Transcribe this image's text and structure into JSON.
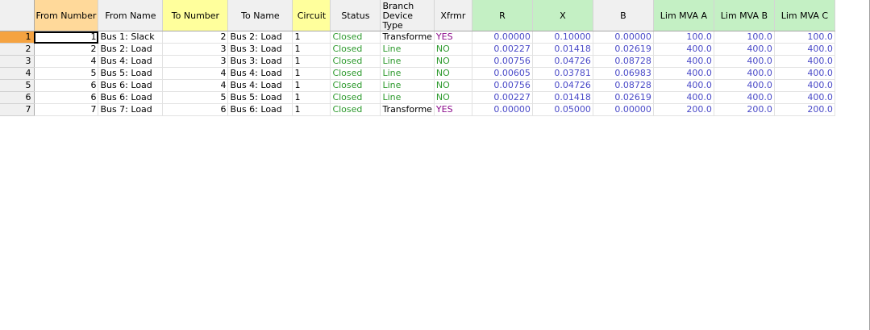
{
  "columns": [
    {
      "key": "from_number",
      "label": "From Number"
    },
    {
      "key": "from_name",
      "label": "From Name"
    },
    {
      "key": "to_number",
      "label": "To Number"
    },
    {
      "key": "to_name",
      "label": "To Name"
    },
    {
      "key": "circuit",
      "label": "Circuit"
    },
    {
      "key": "status",
      "label": "Status"
    },
    {
      "key": "branch_device_type",
      "label": "Branch Device Type"
    },
    {
      "key": "xfrmr",
      "label": "Xfrmr"
    },
    {
      "key": "r",
      "label": "R"
    },
    {
      "key": "x",
      "label": "X"
    },
    {
      "key": "b",
      "label": "B"
    },
    {
      "key": "lim_mva_a",
      "label": "Lim MVA A"
    },
    {
      "key": "lim_mva_b",
      "label": "Lim MVA B"
    },
    {
      "key": "lim_mva_c",
      "label": "Lim MVA C"
    }
  ],
  "rows": [
    {
      "row": "1",
      "from_number": "1",
      "from_name": "Bus 1: Slack",
      "to_number": "2",
      "to_name": "Bus 2: Load",
      "circuit": "1",
      "status": "Closed",
      "branch_device_type": "Transforme",
      "xfrmr": "YES",
      "r": "0.00000",
      "x": "0.10000",
      "b": "0.00000",
      "lim_mva_a": "100.0",
      "lim_mva_b": "100.0",
      "lim_mva_c": "100.0"
    },
    {
      "row": "2",
      "from_number": "2",
      "from_name": "Bus 2: Load",
      "to_number": "3",
      "to_name": "Bus 3: Load",
      "circuit": "1",
      "status": "Closed",
      "branch_device_type": "Line",
      "xfrmr": "NO",
      "r": "0.00227",
      "x": "0.01418",
      "b": "0.02619",
      "lim_mva_a": "400.0",
      "lim_mva_b": "400.0",
      "lim_mva_c": "400.0"
    },
    {
      "row": "3",
      "from_number": "4",
      "from_name": "Bus 4: Load",
      "to_number": "3",
      "to_name": "Bus 3: Load",
      "circuit": "1",
      "status": "Closed",
      "branch_device_type": "Line",
      "xfrmr": "NO",
      "r": "0.00756",
      "x": "0.04726",
      "b": "0.08728",
      "lim_mva_a": "400.0",
      "lim_mva_b": "400.0",
      "lim_mva_c": "400.0"
    },
    {
      "row": "4",
      "from_number": "5",
      "from_name": "Bus 5: Load",
      "to_number": "4",
      "to_name": "Bus 4: Load",
      "circuit": "1",
      "status": "Closed",
      "branch_device_type": "Line",
      "xfrmr": "NO",
      "r": "0.00605",
      "x": "0.03781",
      "b": "0.06983",
      "lim_mva_a": "400.0",
      "lim_mva_b": "400.0",
      "lim_mva_c": "400.0"
    },
    {
      "row": "5",
      "from_number": "6",
      "from_name": "Bus 6: Load",
      "to_number": "4",
      "to_name": "Bus 4: Load",
      "circuit": "1",
      "status": "Closed",
      "branch_device_type": "Line",
      "xfrmr": "NO",
      "r": "0.00756",
      "x": "0.04726",
      "b": "0.08728",
      "lim_mva_a": "400.0",
      "lim_mva_b": "400.0",
      "lim_mva_c": "400.0"
    },
    {
      "row": "6",
      "from_number": "6",
      "from_name": "Bus 6: Load",
      "to_number": "5",
      "to_name": "Bus 5: Load",
      "circuit": "1",
      "status": "Closed",
      "branch_device_type": "Line",
      "xfrmr": "NO",
      "r": "0.00227",
      "x": "0.01418",
      "b": "0.02619",
      "lim_mva_a": "400.0",
      "lim_mva_b": "400.0",
      "lim_mva_c": "400.0"
    },
    {
      "row": "7",
      "from_number": "7",
      "from_name": "Bus 7: Load",
      "to_number": "6",
      "to_name": "Bus 6: Load",
      "circuit": "1",
      "status": "Closed",
      "branch_device_type": "Transforme",
      "xfrmr": "YES",
      "r": "0.00000",
      "x": "0.05000",
      "b": "0.00000",
      "lim_mva_a": "200.0",
      "lim_mva_b": "200.0",
      "lim_mva_c": "200.0"
    }
  ],
  "colors": {
    "header_key_from": "#ffd99a",
    "header_key_to": "#ffff9c",
    "header_editable": "#c4f0c4",
    "row_selected": "#f5a341",
    "value_blue": "#4a4ac8",
    "value_green": "#2e9a2e",
    "value_purple": "#8b0a8b"
  }
}
